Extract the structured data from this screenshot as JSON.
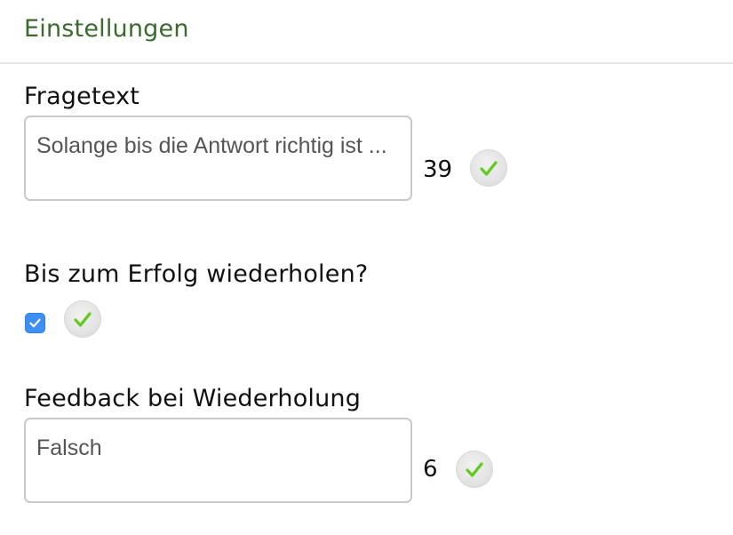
{
  "header": {
    "title": "Einstellungen"
  },
  "fragetext": {
    "label": "Fragetext",
    "value": "Solange bis die Antwort richtig ist ...",
    "char_count": "39"
  },
  "repeat_until_success": {
    "label": "Bis zum Erfolg wiederholen?",
    "checked": true
  },
  "feedback": {
    "label": "Feedback bei Wiederholung",
    "value": "Falsch",
    "char_count": "6"
  },
  "icons": {
    "valid": "checkmark-icon",
    "resize": "resize-grip-icon"
  },
  "colors": {
    "header_text": "#3b6a2e",
    "checkbox": "#3d8ef5",
    "check_green": "#6fd12a"
  }
}
